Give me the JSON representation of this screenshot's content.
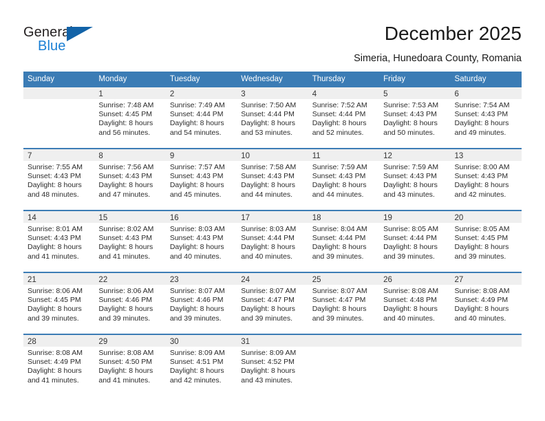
{
  "brand": {
    "name_part1": "General",
    "name_part2": "Blue",
    "triangle_icon": "triangle-icon",
    "accent_color": "#1263a8",
    "text_color": "#1a7fd4"
  },
  "header": {
    "title": "December 2025",
    "subtitle": "Simeria, Hunedoara County, Romania"
  },
  "calendar": {
    "header_bg": "#3b7cb5",
    "daynum_bg": "#efefef",
    "weekday_headers": [
      "Sunday",
      "Monday",
      "Tuesday",
      "Wednesday",
      "Thursday",
      "Friday",
      "Saturday"
    ],
    "weeks": [
      [
        {
          "day": "",
          "sunrise": "",
          "sunset": "",
          "daylight_line1": "",
          "daylight_line2": ""
        },
        {
          "day": "1",
          "sunrise": "Sunrise: 7:48 AM",
          "sunset": "Sunset: 4:45 PM",
          "daylight_line1": "Daylight: 8 hours",
          "daylight_line2": "and 56 minutes."
        },
        {
          "day": "2",
          "sunrise": "Sunrise: 7:49 AM",
          "sunset": "Sunset: 4:44 PM",
          "daylight_line1": "Daylight: 8 hours",
          "daylight_line2": "and 54 minutes."
        },
        {
          "day": "3",
          "sunrise": "Sunrise: 7:50 AM",
          "sunset": "Sunset: 4:44 PM",
          "daylight_line1": "Daylight: 8 hours",
          "daylight_line2": "and 53 minutes."
        },
        {
          "day": "4",
          "sunrise": "Sunrise: 7:52 AM",
          "sunset": "Sunset: 4:44 PM",
          "daylight_line1": "Daylight: 8 hours",
          "daylight_line2": "and 52 minutes."
        },
        {
          "day": "5",
          "sunrise": "Sunrise: 7:53 AM",
          "sunset": "Sunset: 4:43 PM",
          "daylight_line1": "Daylight: 8 hours",
          "daylight_line2": "and 50 minutes."
        },
        {
          "day": "6",
          "sunrise": "Sunrise: 7:54 AM",
          "sunset": "Sunset: 4:43 PM",
          "daylight_line1": "Daylight: 8 hours",
          "daylight_line2": "and 49 minutes."
        }
      ],
      [
        {
          "day": "7",
          "sunrise": "Sunrise: 7:55 AM",
          "sunset": "Sunset: 4:43 PM",
          "daylight_line1": "Daylight: 8 hours",
          "daylight_line2": "and 48 minutes."
        },
        {
          "day": "8",
          "sunrise": "Sunrise: 7:56 AM",
          "sunset": "Sunset: 4:43 PM",
          "daylight_line1": "Daylight: 8 hours",
          "daylight_line2": "and 47 minutes."
        },
        {
          "day": "9",
          "sunrise": "Sunrise: 7:57 AM",
          "sunset": "Sunset: 4:43 PM",
          "daylight_line1": "Daylight: 8 hours",
          "daylight_line2": "and 45 minutes."
        },
        {
          "day": "10",
          "sunrise": "Sunrise: 7:58 AM",
          "sunset": "Sunset: 4:43 PM",
          "daylight_line1": "Daylight: 8 hours",
          "daylight_line2": "and 44 minutes."
        },
        {
          "day": "11",
          "sunrise": "Sunrise: 7:59 AM",
          "sunset": "Sunset: 4:43 PM",
          "daylight_line1": "Daylight: 8 hours",
          "daylight_line2": "and 44 minutes."
        },
        {
          "day": "12",
          "sunrise": "Sunrise: 7:59 AM",
          "sunset": "Sunset: 4:43 PM",
          "daylight_line1": "Daylight: 8 hours",
          "daylight_line2": "and 43 minutes."
        },
        {
          "day": "13",
          "sunrise": "Sunrise: 8:00 AM",
          "sunset": "Sunset: 4:43 PM",
          "daylight_line1": "Daylight: 8 hours",
          "daylight_line2": "and 42 minutes."
        }
      ],
      [
        {
          "day": "14",
          "sunrise": "Sunrise: 8:01 AM",
          "sunset": "Sunset: 4:43 PM",
          "daylight_line1": "Daylight: 8 hours",
          "daylight_line2": "and 41 minutes."
        },
        {
          "day": "15",
          "sunrise": "Sunrise: 8:02 AM",
          "sunset": "Sunset: 4:43 PM",
          "daylight_line1": "Daylight: 8 hours",
          "daylight_line2": "and 41 minutes."
        },
        {
          "day": "16",
          "sunrise": "Sunrise: 8:03 AM",
          "sunset": "Sunset: 4:43 PM",
          "daylight_line1": "Daylight: 8 hours",
          "daylight_line2": "and 40 minutes."
        },
        {
          "day": "17",
          "sunrise": "Sunrise: 8:03 AM",
          "sunset": "Sunset: 4:44 PM",
          "daylight_line1": "Daylight: 8 hours",
          "daylight_line2": "and 40 minutes."
        },
        {
          "day": "18",
          "sunrise": "Sunrise: 8:04 AM",
          "sunset": "Sunset: 4:44 PM",
          "daylight_line1": "Daylight: 8 hours",
          "daylight_line2": "and 39 minutes."
        },
        {
          "day": "19",
          "sunrise": "Sunrise: 8:05 AM",
          "sunset": "Sunset: 4:44 PM",
          "daylight_line1": "Daylight: 8 hours",
          "daylight_line2": "and 39 minutes."
        },
        {
          "day": "20",
          "sunrise": "Sunrise: 8:05 AM",
          "sunset": "Sunset: 4:45 PM",
          "daylight_line1": "Daylight: 8 hours",
          "daylight_line2": "and 39 minutes."
        }
      ],
      [
        {
          "day": "21",
          "sunrise": "Sunrise: 8:06 AM",
          "sunset": "Sunset: 4:45 PM",
          "daylight_line1": "Daylight: 8 hours",
          "daylight_line2": "and 39 minutes."
        },
        {
          "day": "22",
          "sunrise": "Sunrise: 8:06 AM",
          "sunset": "Sunset: 4:46 PM",
          "daylight_line1": "Daylight: 8 hours",
          "daylight_line2": "and 39 minutes."
        },
        {
          "day": "23",
          "sunrise": "Sunrise: 8:07 AM",
          "sunset": "Sunset: 4:46 PM",
          "daylight_line1": "Daylight: 8 hours",
          "daylight_line2": "and 39 minutes."
        },
        {
          "day": "24",
          "sunrise": "Sunrise: 8:07 AM",
          "sunset": "Sunset: 4:47 PM",
          "daylight_line1": "Daylight: 8 hours",
          "daylight_line2": "and 39 minutes."
        },
        {
          "day": "25",
          "sunrise": "Sunrise: 8:07 AM",
          "sunset": "Sunset: 4:47 PM",
          "daylight_line1": "Daylight: 8 hours",
          "daylight_line2": "and 39 minutes."
        },
        {
          "day": "26",
          "sunrise": "Sunrise: 8:08 AM",
          "sunset": "Sunset: 4:48 PM",
          "daylight_line1": "Daylight: 8 hours",
          "daylight_line2": "and 40 minutes."
        },
        {
          "day": "27",
          "sunrise": "Sunrise: 8:08 AM",
          "sunset": "Sunset: 4:49 PM",
          "daylight_line1": "Daylight: 8 hours",
          "daylight_line2": "and 40 minutes."
        }
      ],
      [
        {
          "day": "28",
          "sunrise": "Sunrise: 8:08 AM",
          "sunset": "Sunset: 4:49 PM",
          "daylight_line1": "Daylight: 8 hours",
          "daylight_line2": "and 41 minutes."
        },
        {
          "day": "29",
          "sunrise": "Sunrise: 8:08 AM",
          "sunset": "Sunset: 4:50 PM",
          "daylight_line1": "Daylight: 8 hours",
          "daylight_line2": "and 41 minutes."
        },
        {
          "day": "30",
          "sunrise": "Sunrise: 8:09 AM",
          "sunset": "Sunset: 4:51 PM",
          "daylight_line1": "Daylight: 8 hours",
          "daylight_line2": "and 42 minutes."
        },
        {
          "day": "31",
          "sunrise": "Sunrise: 8:09 AM",
          "sunset": "Sunset: 4:52 PM",
          "daylight_line1": "Daylight: 8 hours",
          "daylight_line2": "and 43 minutes."
        },
        {
          "day": "",
          "sunrise": "",
          "sunset": "",
          "daylight_line1": "",
          "daylight_line2": ""
        },
        {
          "day": "",
          "sunrise": "",
          "sunset": "",
          "daylight_line1": "",
          "daylight_line2": ""
        },
        {
          "day": "",
          "sunrise": "",
          "sunset": "",
          "daylight_line1": "",
          "daylight_line2": ""
        }
      ]
    ]
  }
}
